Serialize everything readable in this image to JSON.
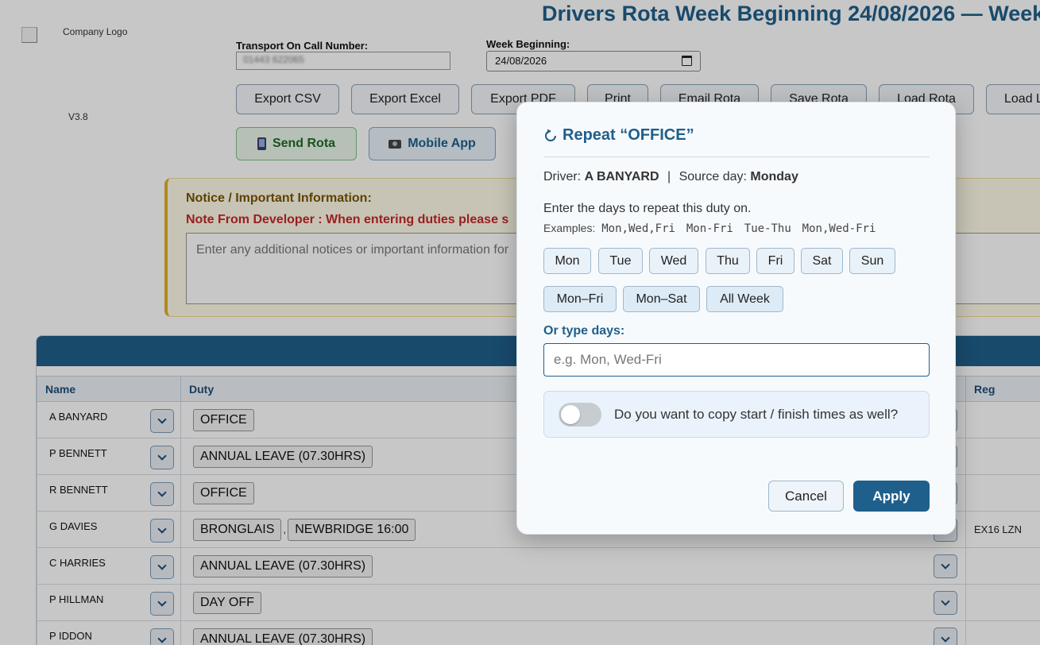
{
  "header": {
    "logo_alt": "Company Logo",
    "version": "V3.8",
    "title": "Drivers Rota Week Beginning 24/08/2026 — Week"
  },
  "fields": {
    "oncall_label": "Transport On Call Number:",
    "oncall_value": "01443 622065",
    "week_label": "Week Beginning:",
    "week_value": "24/08/2026"
  },
  "toolbar": {
    "buttons": [
      "Export CSV",
      "Export Excel",
      "Export PDF",
      "Print",
      "Email Rota",
      "Save Rota",
      "Load Rota",
      "Load L"
    ],
    "send_label": "Send Rota",
    "mobile_label": "Mobile App"
  },
  "notice": {
    "title": "Notice / Important Information:",
    "developer_note": "Note From Developer : When entering duties please s",
    "placeholder": "Enter any additional notices or important information for"
  },
  "table": {
    "headers": {
      "name": "Name",
      "duty": "Duty",
      "reg": "Reg"
    },
    "rows": [
      {
        "name": "A BANYARD",
        "duties": [
          "OFFICE"
        ],
        "reg": ""
      },
      {
        "name": "P BENNETT",
        "duties": [
          "ANNUAL LEAVE (07.30HRS)"
        ],
        "reg": ""
      },
      {
        "name": "R BENNETT",
        "duties": [
          "OFFICE"
        ],
        "reg": ""
      },
      {
        "name": "G DAVIES",
        "duties": [
          "BRONGLAIS",
          "NEWBRIDGE 16:00"
        ],
        "reg": "EX16 LZN"
      },
      {
        "name": "C HARRIES",
        "duties": [
          "ANNUAL LEAVE (07.30HRS)"
        ],
        "reg": ""
      },
      {
        "name": "P HILLMAN",
        "duties": [
          "DAY OFF"
        ],
        "reg": ""
      },
      {
        "name": "P IDDON",
        "duties": [
          "ANNUAL LEAVE (07.30HRS)"
        ],
        "reg": ""
      }
    ]
  },
  "modal": {
    "icon": "repeat-icon",
    "title": "Repeat “OFFICE”",
    "driver_label": "Driver:",
    "driver_name": "A BANYARD",
    "separator": "|",
    "source_label": "Source day:",
    "source_day": "Monday",
    "instruction": "Enter the days to repeat this duty on.",
    "examples_label": "Examples:",
    "examples": [
      "Mon,Wed,Fri",
      "Mon-Fri",
      "Tue-Thu",
      "Mon,Wed-Fri"
    ],
    "days": [
      "Mon",
      "Tue",
      "Wed",
      "Thu",
      "Fri",
      "Sat",
      "Sun"
    ],
    "ranges": [
      "Mon–Fri",
      "Mon–Sat",
      "All Week"
    ],
    "or_type_label": "Or type days:",
    "input_placeholder": "e.g. Mon, Wed-Fri",
    "input_value": "",
    "copy_times_label": "Do you want to copy start / finish times as well?",
    "copy_times_on": false,
    "cancel_label": "Cancel",
    "apply_label": "Apply"
  },
  "colors": {
    "primary": "#1f5f8b",
    "notice_accent": "#e1b12c",
    "developer_note": "#c62828",
    "send_green": "#1f6b2a"
  }
}
